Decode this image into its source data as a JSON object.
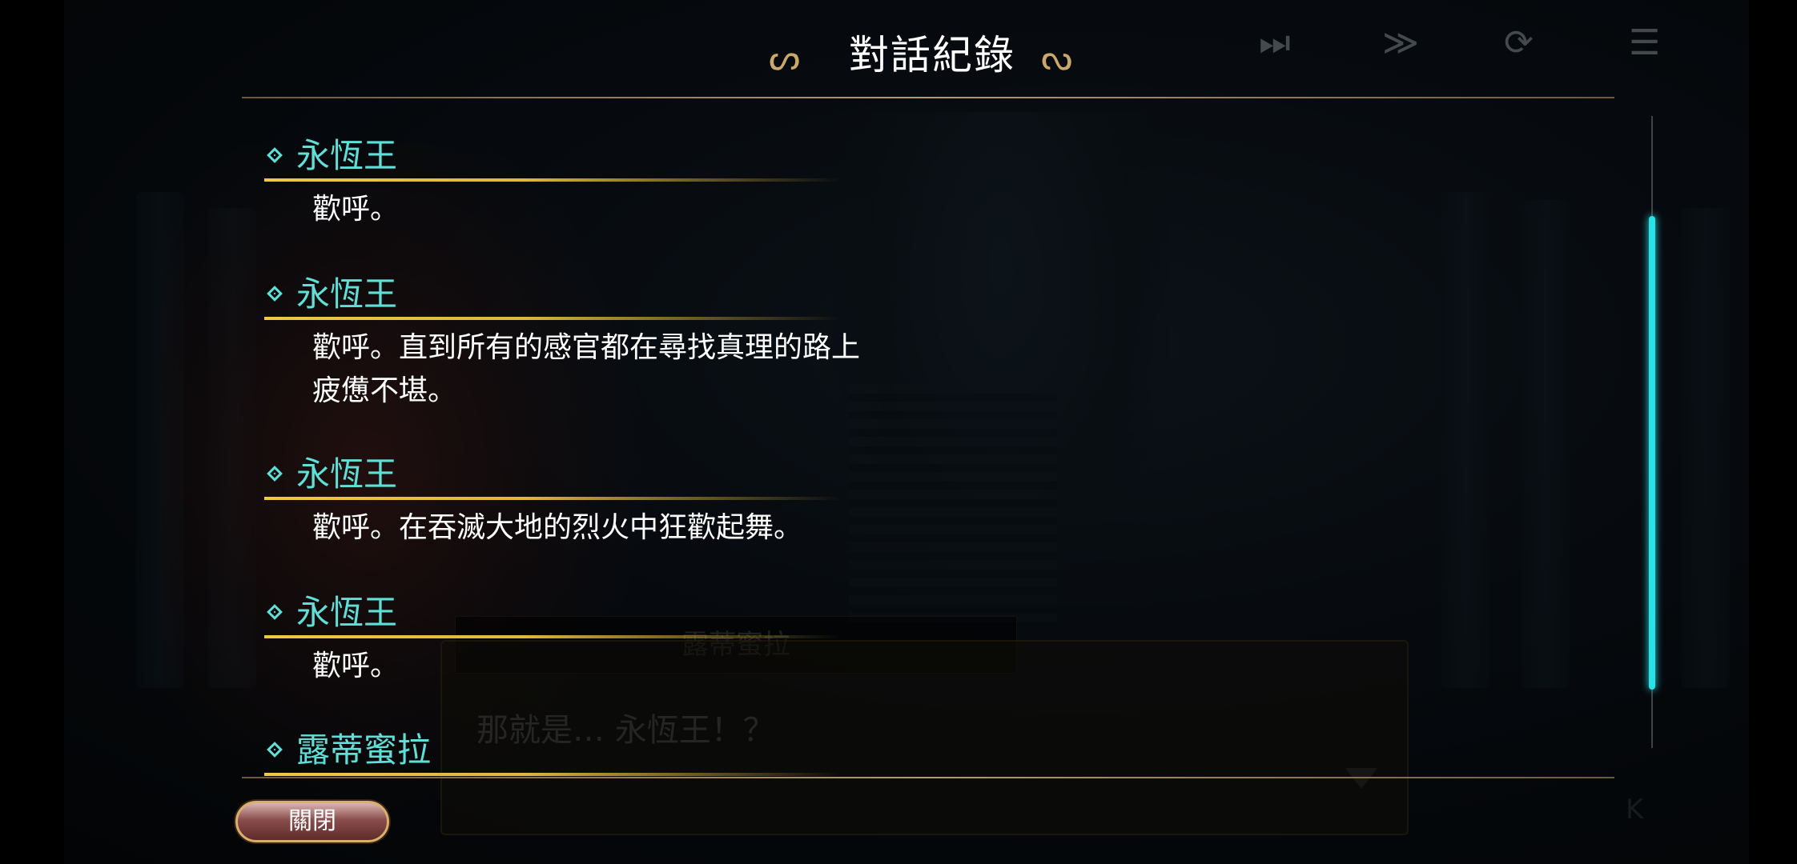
{
  "header": {
    "title": "對話紀錄",
    "ornament_left": "ᔕ",
    "ornament_right": "ᔓ"
  },
  "toolbar": {
    "skip_icon": "⏭",
    "fast_forward_icon": "≫",
    "auto_icon": "⟳",
    "log_icon": "☰"
  },
  "log_entries": [
    {
      "speaker": "永恆王",
      "lines": [
        "歡呼。"
      ]
    },
    {
      "speaker": "永恆王",
      "lines": [
        "歡呼。直到所有的感官都在尋找真理的路上",
        "疲憊不堪。"
      ]
    },
    {
      "speaker": "永恆王",
      "lines": [
        "歡呼。在吞滅大地的烈火中狂歡起舞。"
      ]
    },
    {
      "speaker": "永恆王",
      "lines": [
        "歡呼。"
      ]
    },
    {
      "speaker": "露蒂蜜拉",
      "lines": []
    }
  ],
  "background_dialog": {
    "name": "露蒂蜜拉",
    "text": "那就是… 永恆王！？",
    "skip_glyph": "K"
  },
  "close_button": {
    "label": "關閉"
  },
  "colors": {
    "speaker": "#5ee0d8",
    "underline": "#f0c842",
    "scrollbar": "#29e2e8",
    "rule": "#b59c62"
  }
}
